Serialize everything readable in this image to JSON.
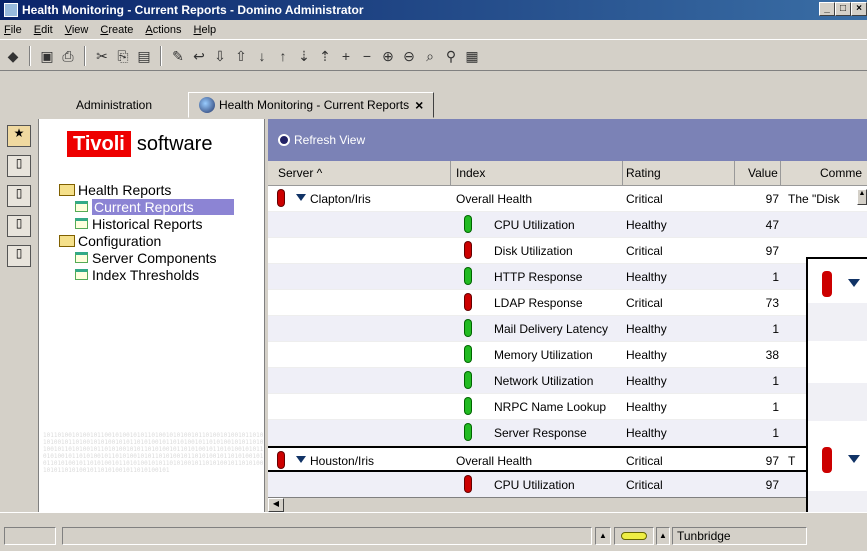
{
  "window": {
    "title": "Health Monitoring - Current Reports - Domino Administrator",
    "controls": [
      "_",
      "□",
      "×"
    ]
  },
  "menu": [
    "File",
    "Edit",
    "View",
    "Create",
    "Actions",
    "Help"
  ],
  "tabs": [
    {
      "label": "Administration"
    },
    {
      "label": "Health Monitoring - Current Reports"
    }
  ],
  "logo": {
    "brand": "Tivoli",
    "suffix": "software"
  },
  "tree": {
    "items": [
      {
        "label": "Health Reports",
        "level": 0,
        "icon": "folder-open-icon"
      },
      {
        "label": "Current Reports",
        "level": 1,
        "icon": "view-icon",
        "selected": true
      },
      {
        "label": "Historical Reports",
        "level": 1,
        "icon": "view-icon"
      },
      {
        "label": "Configuration",
        "level": 0,
        "icon": "folder-open-icon"
      },
      {
        "label": "Server Components",
        "level": 1,
        "icon": "view-icon"
      },
      {
        "label": "Index Thresholds",
        "level": 1,
        "icon": "view-icon"
      }
    ]
  },
  "actions": {
    "refresh": "Refresh View"
  },
  "columns": [
    "Server ^",
    "Index",
    "Rating",
    "Value",
    "Comme"
  ],
  "rows": [
    {
      "server": "Clapton/Iris",
      "index": "Overall Health",
      "rating": "Critical",
      "value": "97",
      "comment": "The \"Disk",
      "status": "critical",
      "group": true
    },
    {
      "server": "",
      "index": "CPU Utilization",
      "rating": "Healthy",
      "value": "47",
      "comment": "",
      "status": "healthy"
    },
    {
      "server": "",
      "index": "Disk Utilization",
      "rating": "Critical",
      "value": "97",
      "comment": "",
      "status": "critical"
    },
    {
      "server": "",
      "index": "HTTP Response",
      "rating": "Healthy",
      "value": "1",
      "comment": "",
      "status": "healthy"
    },
    {
      "server": "",
      "index": "LDAP Response",
      "rating": "Critical",
      "value": "73",
      "comment": "",
      "status": "critical"
    },
    {
      "server": "",
      "index": "Mail Delivery Latency",
      "rating": "Healthy",
      "value": "1",
      "comment": "",
      "status": "healthy"
    },
    {
      "server": "",
      "index": "Memory Utilization",
      "rating": "Healthy",
      "value": "38",
      "comment": "",
      "status": "healthy"
    },
    {
      "server": "",
      "index": "Network Utilization",
      "rating": "Healthy",
      "value": "1",
      "comment": "",
      "status": "healthy"
    },
    {
      "server": "",
      "index": "NRPC Name Lookup",
      "rating": "Healthy",
      "value": "1",
      "comment": "",
      "status": "healthy"
    },
    {
      "server": "",
      "index": "Server Response",
      "rating": "Healthy",
      "value": "1",
      "comment": "",
      "status": "healthy"
    },
    {
      "server": "Houston/Iris",
      "index": "Overall Health",
      "rating": "Critical",
      "value": "97",
      "comment": "T",
      "status": "critical",
      "group": true
    },
    {
      "server": "",
      "index": "CPU Utilization",
      "rating": "Critical",
      "value": "97",
      "comment": "",
      "status": "critical"
    }
  ],
  "status": {
    "location": "Tunbridge"
  },
  "colors": {
    "critical": "#cc0000",
    "healthy": "#22bb22",
    "action_bar": "#7b82b6",
    "selection": "#8c84d4",
    "brand_red": "#ee0000"
  }
}
